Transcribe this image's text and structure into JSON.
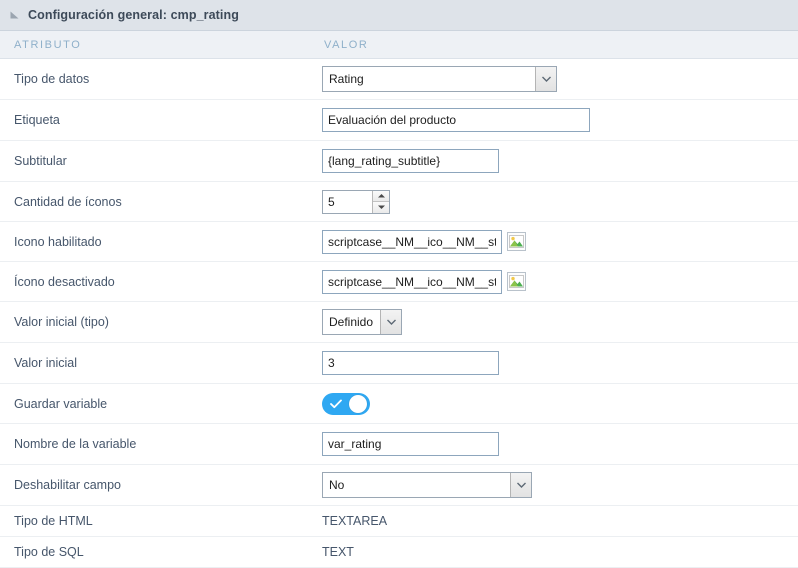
{
  "panel": {
    "title": "Configuración general: cmp_rating",
    "collapse_icon": "collapse-triangle-icon"
  },
  "columns": {
    "attribute": "ATRIBUTO",
    "value": "VALOR"
  },
  "rows": {
    "tipo_datos": {
      "label": "Tipo de datos",
      "value": "Rating",
      "control": "select"
    },
    "etiqueta": {
      "label": "Etiqueta",
      "value": "Evaluación del producto",
      "control": "text"
    },
    "subtitular": {
      "label": "Subtitular",
      "value": "{lang_rating_subtitle}",
      "control": "text"
    },
    "cantidad_iconos": {
      "label": "Cantidad de íconos",
      "value": "5",
      "control": "spinner"
    },
    "icono_habilitado": {
      "label": "Icono habilitado",
      "value": "scriptcase__NM__ico__NM__star.p",
      "control": "text-with-image-picker",
      "picker_icon": "image-picker-icon"
    },
    "icono_desactivado": {
      "label": "Ícono desactivado",
      "value": "scriptcase__NM__ico__NM__star_c",
      "control": "text-with-image-picker",
      "picker_icon": "image-picker-icon"
    },
    "valor_inicial_tipo": {
      "label": "Valor inicial (tipo)",
      "value": "Definido",
      "control": "select"
    },
    "valor_inicial": {
      "label": "Valor inicial",
      "value": "3",
      "control": "text"
    },
    "guardar_variable": {
      "label": "Guardar variable",
      "value": "on",
      "control": "toggle",
      "check_icon": "check-icon"
    },
    "nombre_variable": {
      "label": "Nombre de la variable",
      "value": "var_rating",
      "control": "text"
    },
    "deshabilitar_campo": {
      "label": "Deshabilitar campo",
      "value": "No",
      "control": "select"
    },
    "tipo_html": {
      "label": "Tipo de HTML",
      "value": "TEXTAREA",
      "control": "static"
    },
    "tipo_sql": {
      "label": "Tipo de SQL",
      "value": "TEXT",
      "control": "static"
    }
  },
  "colors": {
    "header_bg": "#dee3e9",
    "col_header_bg": "#eef1f5",
    "col_header_text": "#8fb0ca",
    "label_text": "#46566b",
    "toggle_on": "#2fa8f2",
    "input_border": "#8da6bd"
  }
}
